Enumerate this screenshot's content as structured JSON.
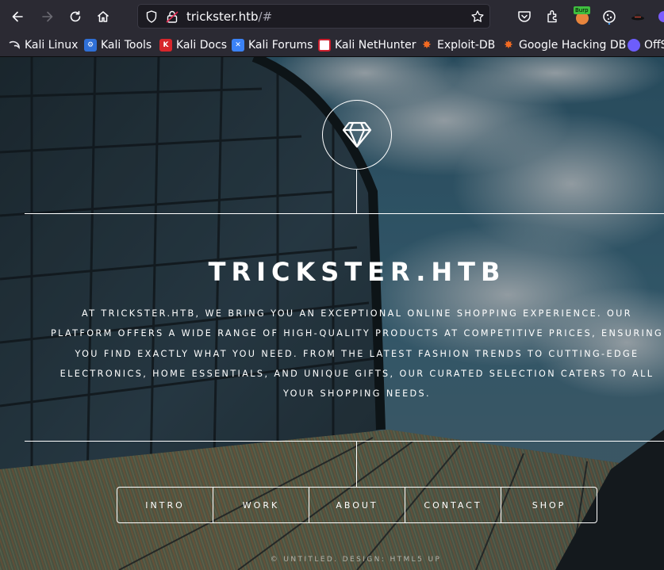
{
  "browser": {
    "url_host": "trickster.htb",
    "url_path": "/#",
    "extension_badge": "Burp",
    "bookmarks": [
      {
        "label": "Kali Linux",
        "icon": "kali-dragon-icon",
        "color": "#1f2937"
      },
      {
        "label": "Kali Tools",
        "icon": "kali-tools-icon",
        "color": "#2f6fd6"
      },
      {
        "label": "Kali Docs",
        "icon": "kali-docs-icon",
        "color": "#d7262b"
      },
      {
        "label": "Kali Forums",
        "icon": "kali-forums-icon",
        "color": "#3b82f6"
      },
      {
        "label": "Kali NetHunter",
        "icon": "nethunter-icon",
        "color": "#cc1f2d"
      },
      {
        "label": "Exploit-DB",
        "icon": "exploit-db-icon",
        "color": "#f16a22"
      },
      {
        "label": "Google Hacking DB",
        "icon": "ghdb-icon",
        "color": "#f16a22"
      },
      {
        "label": "OffS",
        "icon": "offsec-icon",
        "color": "#6d5dfc"
      }
    ]
  },
  "site": {
    "title": "TRICKSTER.HTB",
    "description": "At trickster.htb, we bring you an exceptional online shopping experience. Our platform offers a wide range of high-quality products at competitive prices, ensuring you find exactly what you need. From the latest fashion trends to cutting-edge electronics, home essentials, and unique gifts, our curated selection caters to all your shopping needs.",
    "nav": [
      "Intro",
      "Work",
      "About",
      "Contact",
      "Shop"
    ],
    "credits": "© Untitled. Design: HTML5 UP",
    "logo_icon": "diamond-icon"
  }
}
